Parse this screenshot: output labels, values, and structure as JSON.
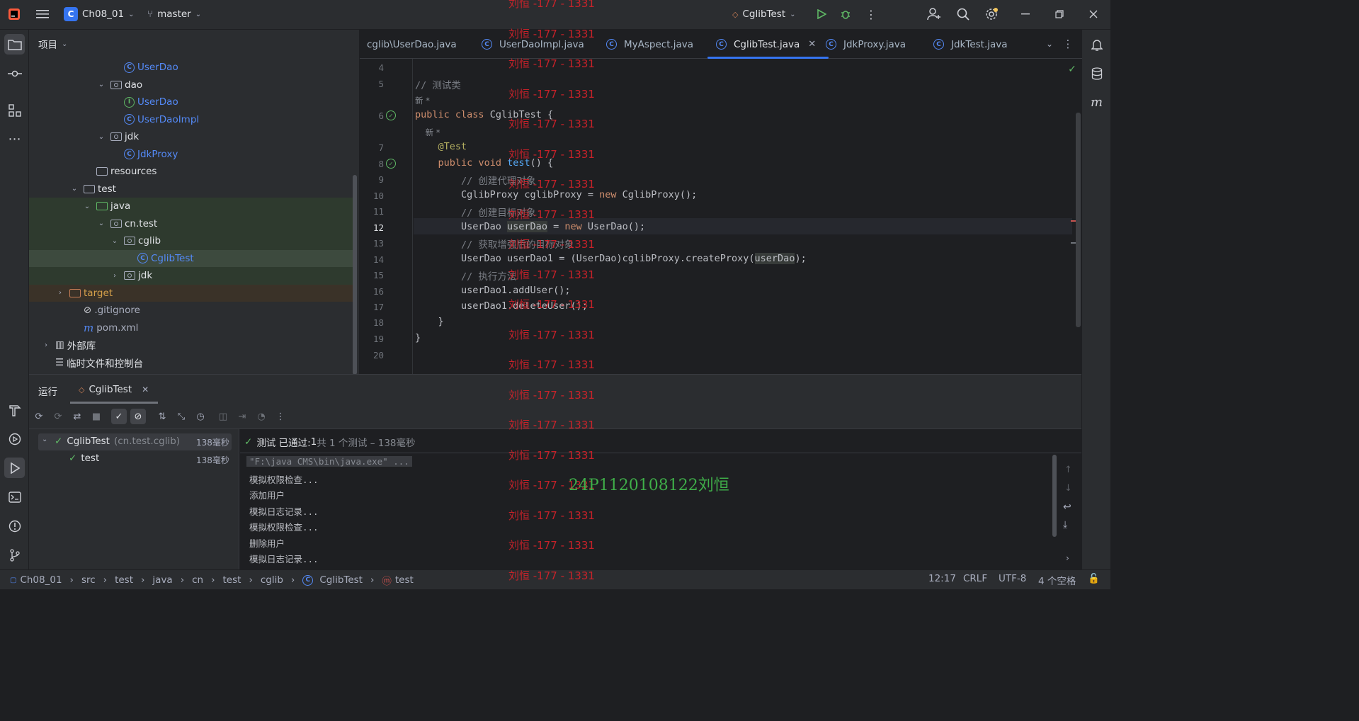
{
  "titlebar": {
    "project": "Ch08_01",
    "project_badge": "C",
    "branch": "master",
    "run_config": "CglibTest"
  },
  "project_panel": {
    "title": "项目",
    "tree": [
      {
        "label": "UserDao",
        "icon": "class-icon",
        "depth": 4,
        "arrow": ""
      },
      {
        "label": "dao",
        "icon": "package-icon",
        "depth": 3,
        "arrow": "expanded"
      },
      {
        "label": "UserDao",
        "icon": "interface-icon",
        "depth": 4,
        "arrow": ""
      },
      {
        "label": "UserDaoImpl",
        "icon": "class-icon",
        "depth": 4,
        "arrow": ""
      },
      {
        "label": "jdk",
        "icon": "package-icon",
        "depth": 3,
        "arrow": "expanded"
      },
      {
        "label": "JdkProxy",
        "icon": "class-icon",
        "depth": 4,
        "arrow": ""
      },
      {
        "label": "resources",
        "icon": "resources-folder-icon",
        "depth": 2,
        "arrow": ""
      },
      {
        "label": "test",
        "icon": "folder-icon",
        "depth": 1,
        "arrow": "expanded"
      },
      {
        "label": "java",
        "icon": "test-folder-icon",
        "depth": 2,
        "arrow": "expanded"
      },
      {
        "label": "cn.test",
        "icon": "package-icon",
        "depth": 3,
        "arrow": "expanded"
      },
      {
        "label": "cglib",
        "icon": "package-icon",
        "depth": 4,
        "arrow": "expanded"
      },
      {
        "label": "CglibTest",
        "icon": "class-icon",
        "depth": 5,
        "arrow": ""
      },
      {
        "label": "jdk",
        "icon": "package-icon",
        "depth": 4,
        "arrow": "collapsed"
      },
      {
        "label": "target",
        "icon": "excluded-folder-icon",
        "depth": 0,
        "arrow": "collapsed"
      },
      {
        "label": ".gitignore",
        "icon": "ignore-file-icon",
        "depth": 1,
        "arrow": ""
      },
      {
        "label": "pom.xml",
        "icon": "maven-icon",
        "depth": 1,
        "arrow": ""
      },
      {
        "label": "外部库",
        "icon": "library-icon",
        "depth": -1,
        "arrow": "collapsed"
      },
      {
        "label": "临时文件和控制台",
        "icon": "scratches-icon",
        "depth": -1,
        "arrow": ""
      }
    ]
  },
  "editor": {
    "tabs": [
      {
        "label": "cglib\\UserDao.java",
        "icon": ""
      },
      {
        "label": "UserDaoImpl.java",
        "icon": "class-icon"
      },
      {
        "label": "MyAspect.java",
        "icon": "class-icon"
      },
      {
        "label": "CglibTest.java",
        "icon": "class-icon",
        "active": true
      },
      {
        "label": "JdkProxy.java",
        "icon": "class-icon"
      },
      {
        "label": "JdkTest.java",
        "icon": "class-icon"
      }
    ],
    "lines": [
      {
        "n": "4",
        "text": ""
      },
      {
        "n": "5",
        "text": "// 测试类"
      },
      {
        "n": "",
        "hint": "新 *"
      },
      {
        "n": "6",
        "text": "public class CglibTest {"
      },
      {
        "n": "",
        "hint": "新 *"
      },
      {
        "n": "7",
        "text": "@Test"
      },
      {
        "n": "8",
        "text": "public void test() {"
      },
      {
        "n": "9",
        "text": "// 创建代理对象"
      },
      {
        "n": "10",
        "text": "CglibProxy cglibProxy = new CglibProxy();"
      },
      {
        "n": "11",
        "text": "// 创建目标对象"
      },
      {
        "n": "12",
        "text": "UserDao userDao = new UserDao();"
      },
      {
        "n": "13",
        "text": "// 获取增强后的目标对象"
      },
      {
        "n": "14",
        "text": "UserDao userDao1 = (UserDao)cglibProxy.createProxy(userDao);"
      },
      {
        "n": "15",
        "text": "// 执行方法"
      },
      {
        "n": "16",
        "text": "userDao1.addUser();"
      },
      {
        "n": "17",
        "text": "userDao1.deleteUser();"
      },
      {
        "n": "18",
        "text": "}"
      },
      {
        "n": "19",
        "text": "}"
      },
      {
        "n": "20",
        "text": ""
      }
    ]
  },
  "run_panel": {
    "title": "运行",
    "tab": "CglibTest",
    "summary_prefix": "测试 已通过: ",
    "summary_count": "1",
    "summary_rest": "共 1 个测试 – 138毫秒",
    "tree": [
      {
        "label": "CglibTest",
        "sub": "(cn.test.cglib)",
        "time": "138毫秒"
      },
      {
        "label": "test",
        "sub": "",
        "time": "138毫秒"
      }
    ],
    "console": [
      "\"F:\\java CMS\\bin\\java.exe\" ...",
      "模拟权限检查...",
      "添加用户",
      "模拟日志记录...",
      "模拟权限检查...",
      "删除用户",
      "模拟日志记录..."
    ]
  },
  "statusbar": {
    "breadcrumbs": [
      "Ch08_01",
      "src",
      "test",
      "java",
      "cn",
      "test",
      "cglib",
      "CglibTest",
      "test"
    ],
    "position": "12:17",
    "line_sep": "CRLF",
    "encoding": "UTF-8",
    "indent": "4 个空格"
  },
  "watermark": {
    "text": "刘恒 -177 - 1331",
    "student": "24P1120108122刘恒"
  },
  "colors": {
    "accent": "#3574f0",
    "pass": "#5fb865",
    "watermark": "#d9222a",
    "student": "#3fae49"
  }
}
